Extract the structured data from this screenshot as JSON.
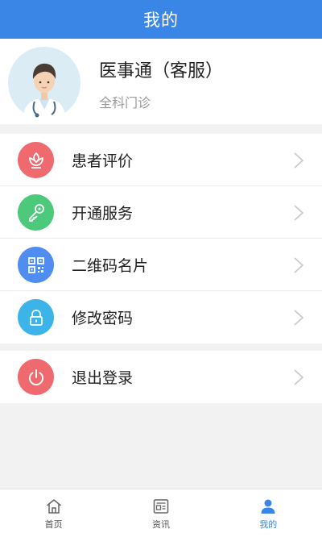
{
  "header": {
    "title": "我的"
  },
  "profile": {
    "name": "医事通（客服）",
    "department": "全科门诊"
  },
  "menu_main": [
    {
      "label": "患者评价",
      "icon": "flower-icon",
      "color": "#ee6a6f"
    },
    {
      "label": "开通服务",
      "icon": "key-icon",
      "color": "#4cc97a"
    },
    {
      "label": "二维码名片",
      "icon": "qr-code-icon",
      "color": "#4f8ef0"
    },
    {
      "label": "修改密码",
      "icon": "lock-icon",
      "color": "#3cb4ea"
    }
  ],
  "menu_logout": {
    "label": "退出登录",
    "icon": "power-icon",
    "color": "#ee6a6f"
  },
  "tabbar": {
    "tabs": [
      {
        "label": "首页",
        "icon": "home-icon"
      },
      {
        "label": "资讯",
        "icon": "news-icon"
      },
      {
        "label": "我的",
        "icon": "person-icon"
      }
    ],
    "active_index": 2,
    "active_color": "#3a86e6",
    "inactive_color": "#555555"
  },
  "accent_color": "#3a86e6"
}
